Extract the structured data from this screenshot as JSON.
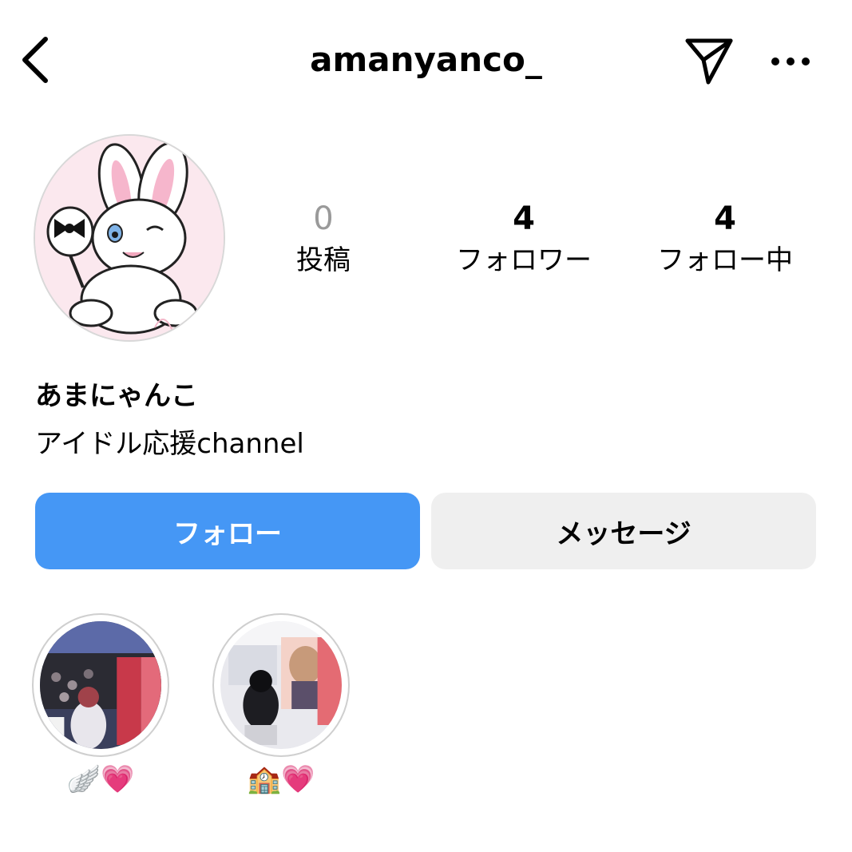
{
  "header": {
    "username": "amanyanco_",
    "back_icon": "chevron-left-icon",
    "send_icon": "paper-plane-icon",
    "more_icon": "more-horizontal-icon"
  },
  "profile": {
    "avatar_icon": "bunny-illustration",
    "display_name": "あまにゃんこ",
    "bio": "アイドル応援channel"
  },
  "stats": {
    "posts": {
      "count": "0",
      "label": "投稿"
    },
    "followers": {
      "count": "4",
      "label": "フォロワー"
    },
    "following": {
      "count": "4",
      "label": "フォロー中"
    }
  },
  "actions": {
    "follow_label": "フォロー",
    "message_label": "メッセージ"
  },
  "highlights": [
    {
      "label": "🪽💗"
    },
    {
      "label": "🏫💗"
    }
  ],
  "colors": {
    "follow_button": "#4597f5",
    "message_button": "#efefef",
    "muted_count": "#9a9a9a"
  }
}
